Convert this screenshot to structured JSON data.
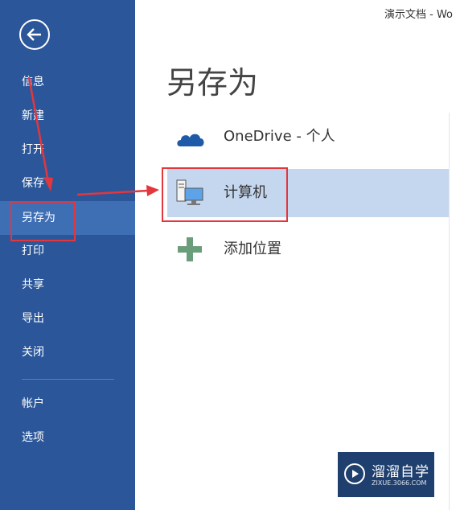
{
  "window": {
    "title": "演示文档 - Wo"
  },
  "sidebar": {
    "back_icon": "back-arrow-icon",
    "items": [
      {
        "label": "信息"
      },
      {
        "label": "新建"
      },
      {
        "label": "打开"
      },
      {
        "label": "保存"
      },
      {
        "label": "另存为",
        "active": true
      },
      {
        "label": "打印"
      },
      {
        "label": "共享"
      },
      {
        "label": "导出"
      },
      {
        "label": "关闭"
      },
      {
        "label": "帐户"
      },
      {
        "label": "选项"
      }
    ]
  },
  "main": {
    "title": "另存为",
    "locations": [
      {
        "label": "OneDrive - 个人",
        "icon": "onedrive-cloud-icon"
      },
      {
        "label": "计算机",
        "icon": "computer-icon",
        "selected": true
      },
      {
        "label": "添加位置",
        "icon": "add-plus-icon"
      }
    ]
  },
  "watermark": {
    "title": "溜溜自学",
    "subtitle": "ZIXUE.3066.COM"
  },
  "colors": {
    "sidebar": "#2b579a",
    "sidebar_active": "#3e6fb5",
    "selected": "#c5d7ef",
    "annotation": "#e3363d"
  }
}
